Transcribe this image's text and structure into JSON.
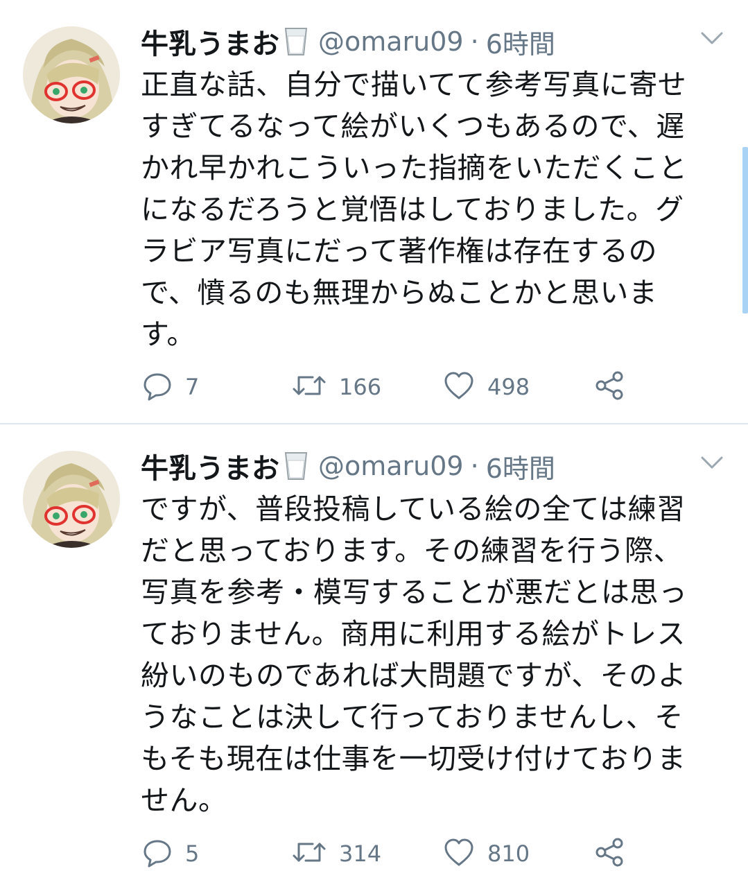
{
  "tweets": [
    {
      "display_name": "牛乳うまお",
      "handle": "@omaru09",
      "separator": "·",
      "time": "6時間",
      "text": "正直な話、自分で描いてて参考写真に寄せ\nすぎてるなって絵がいくつもあるので、遅\nかれ早かれこういった指摘をいただくこと\nになるだろうと覚悟はしておりました。グ\nラビア写真にだって著作権は存在するの\nで、憤るのも無理からぬことかと思いま\nす。",
      "replies": "7",
      "retweets": "166",
      "likes": "498"
    },
    {
      "display_name": "牛乳うまお",
      "handle": "@omaru09",
      "separator": "·",
      "time": "6時間",
      "text": "ですが、普段投稿している絵の全ては練習\nだと思っております。その練習を行う際、\n写真を参考・模写することが悪だとは思っ\nておりません。商用に利用する絵がトレス\n紛いのものであれば大問題ですが、そのよ\nうなことは決して行っておりませんし、そ\nもそも現在は仕事を一切受け付けておりま\nせん。",
      "replies": "5",
      "retweets": "314",
      "likes": "810"
    }
  ],
  "icons": {
    "name_badge": "milk-glass-icon",
    "menu": "chevron-down-icon",
    "reply": "reply-icon",
    "retweet": "retweet-icon",
    "like": "heart-icon",
    "share": "share-icon"
  },
  "colors": {
    "text": "#14171a",
    "secondary": "#657786",
    "divider": "#e1e8ed",
    "scrollbar": "#a9d3f5"
  }
}
